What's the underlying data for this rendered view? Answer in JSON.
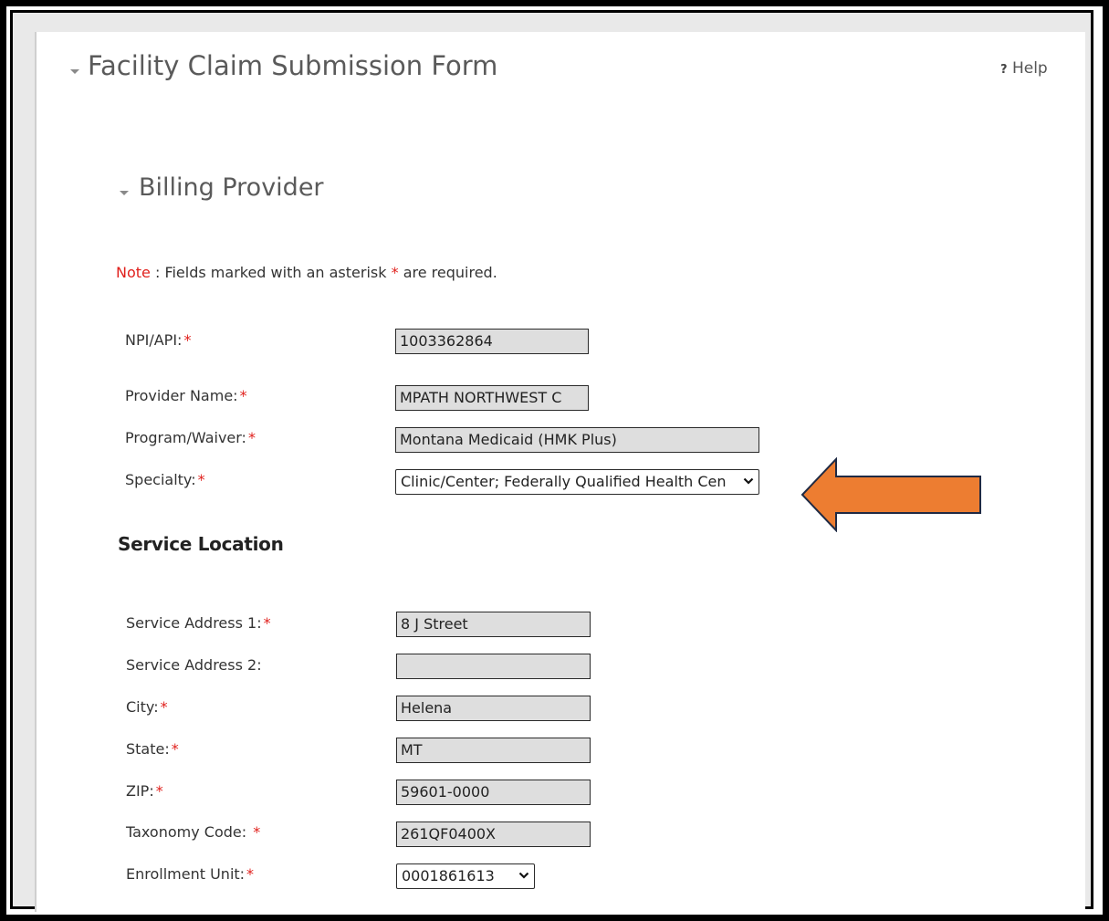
{
  "form": {
    "title": "Facility Claim Submission Form",
    "help_label": "Help",
    "help_icon": "?"
  },
  "billing": {
    "title": "Billing Provider",
    "note_prefix": "Note",
    "note_text": ": Fields marked with an asterisk",
    "note_star": "*",
    "note_suffix": "are required.",
    "npi_label": "NPI/API:",
    "npi_value": "1003362864",
    "provider_name_label": "Provider Name:",
    "provider_name_value": "MPATH NORTHWEST C",
    "program_label": "Program/Waiver:",
    "program_value": "Montana Medicaid (HMK Plus)",
    "specialty_label": "Specialty:",
    "specialty_value": "Clinic/Center; Federally Qualified Health Cen"
  },
  "service_location": {
    "title": "Service Location",
    "address1_label": "Service Address 1:",
    "address1_value": "8 J Street",
    "address2_label": "Service Address 2:",
    "address2_value": "",
    "city_label": "City:",
    "city_value": "Helena",
    "state_label": "State:",
    "state_value": "MT",
    "zip_label": "ZIP:",
    "zip_value": "59601-0000",
    "taxonomy_label": "Taxonomy Code: ",
    "taxonomy_value": "261QF0400X",
    "enrollment_label": "Enrollment Unit:",
    "enrollment_value": "0001861613"
  },
  "required_marker": "*",
  "annotation": {
    "arrow_color": "#ed7d31",
    "arrow_outline": "#1f2a44"
  }
}
